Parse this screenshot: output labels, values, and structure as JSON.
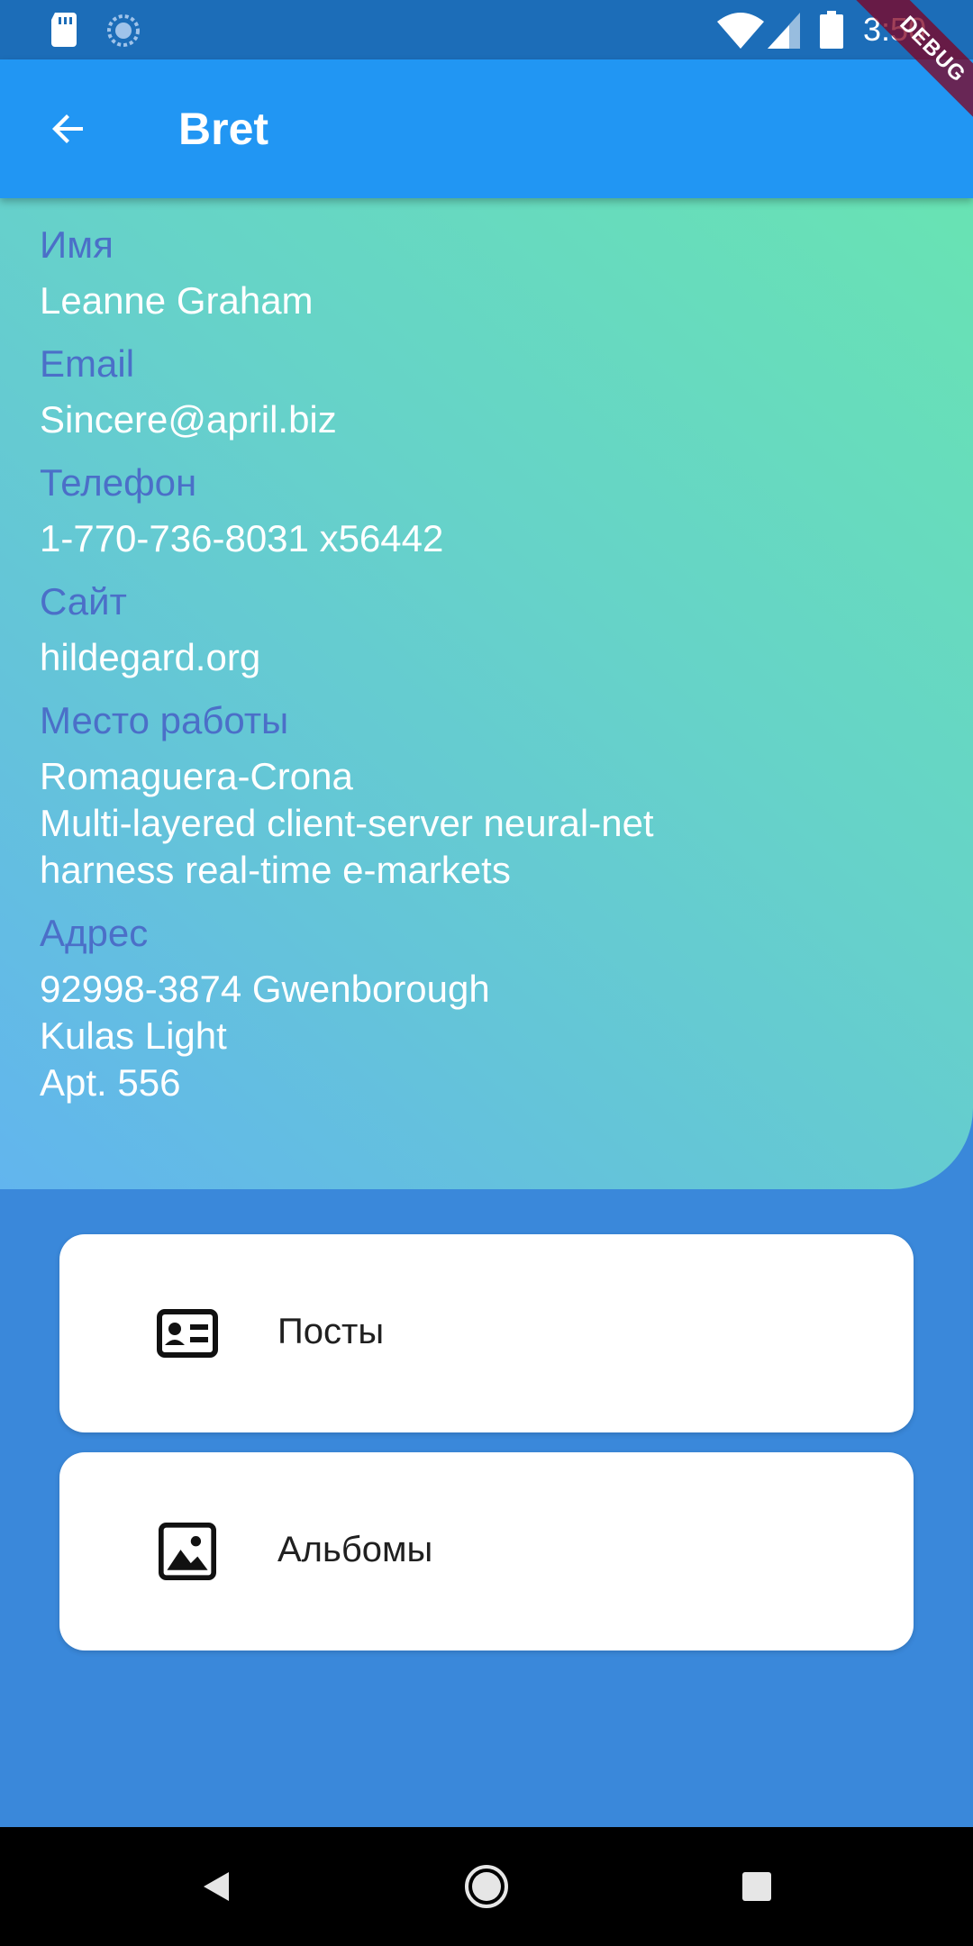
{
  "status_bar": {
    "time": "3:50",
    "icons": [
      "sd-card-icon",
      "sync-icon",
      "wifi-icon",
      "cell-signal-icon",
      "battery-icon"
    ]
  },
  "debug_banner": "DEBUG",
  "app_bar": {
    "title": "Bret",
    "back_icon": "arrow-back-icon"
  },
  "profile": {
    "fields": [
      {
        "label": "Имя",
        "value": "Leanne Graham"
      },
      {
        "label": "Email",
        "value": "Sincere@april.biz"
      },
      {
        "label": "Телефон",
        "value": "1-770-736-8031 x56442"
      },
      {
        "label": "Сайт",
        "value": "hildegard.org"
      },
      {
        "label": "Место работы",
        "value": "Romaguera-Crona\nMulti-layered client-server neural-net\nharness real-time e-markets"
      },
      {
        "label": "Адрес",
        "value": "92998-3874 Gwenborough\nKulas Light\nApt. 556"
      }
    ]
  },
  "cards": [
    {
      "label": "Посты",
      "icon": "id-card-icon"
    },
    {
      "label": "Альбомы",
      "icon": "image-icon"
    }
  ],
  "colors": {
    "status_bar": "#1C6DB8",
    "app_bar": "#2196F3",
    "background": "#3A88DA",
    "label": "#4B6FC8",
    "gradient_start": "#68E3B3",
    "gradient_end": "#62B5EE"
  },
  "nav_bar": {
    "icons": [
      "nav-back-icon",
      "nav-home-icon",
      "nav-recents-icon"
    ]
  }
}
